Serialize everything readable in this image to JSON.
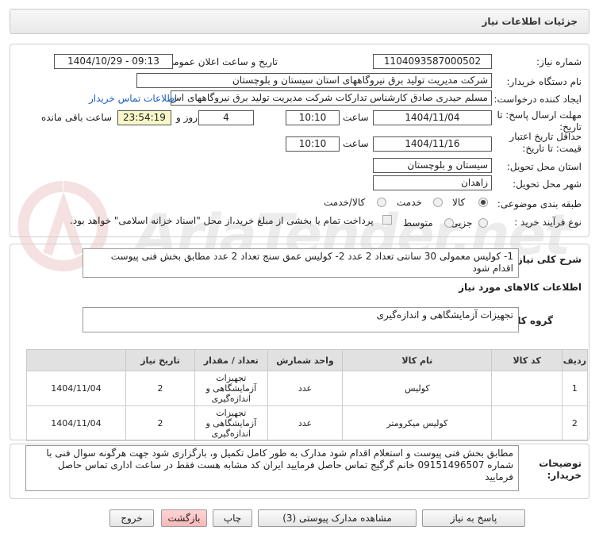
{
  "header": {
    "title": "جزئیات اطلاعات نیاز"
  },
  "watermark": {
    "text": "AriaTender.net"
  },
  "form": {
    "need_number": {
      "label": "شماره نیاز:",
      "value": "1104093587000502"
    },
    "announce": {
      "label": "تاریخ و ساعت اعلان عمومی:",
      "value": "1404/10/29 - 09:13"
    },
    "buyer": {
      "label": "نام دستگاه خریدار:",
      "value": "شرکت مدیریت تولید برق نیروگاههای استان سیستان و بلوچستان"
    },
    "creator": {
      "label": "ایجاد کننده درخواست:",
      "value": "مسلم حیدری صادق کارشناس تدارکات شرکت مدیریت تولید برق نیروگاههای اس",
      "contact_link": "اطلاعات تماس خریدار"
    },
    "deadline": {
      "label_line1": "مهلت ارسال پاسخ: تا",
      "label_line2": "تاریخ:",
      "date": "1404/11/04",
      "time_label": "ساعت",
      "time": "10:10",
      "days": "4",
      "days_label": "روز و",
      "remaining": "23:54:19",
      "remaining_label": "ساعت باقی مانده"
    },
    "validity": {
      "label_line1": "حداقل تاریخ اعتبار",
      "label_line2": "قیمت: تا تاریخ:",
      "date": "1404/11/16",
      "time_label": "ساعت",
      "time": "10:10"
    },
    "province": {
      "label": "استان محل تحویل:",
      "value": "سیستان و بلوچستان"
    },
    "city": {
      "label": "شهر محل تحویل:",
      "value": "زاهدان"
    },
    "category": {
      "label": "طبقه بندی موضوعی:",
      "options": [
        "کالا",
        "خدمت",
        "کالا/خدمت"
      ],
      "selected": "کالا"
    },
    "process": {
      "label": "نوع فرآیند خرید :",
      "options": [
        "جزیی",
        "متوسط"
      ],
      "payment_note": "پرداخت تمام یا بخشی از مبلغ خرید،از محل \"اسناد خزانه اسلامی\" خواهد بود."
    }
  },
  "summary": {
    "label": "شرح کلی نیاز:",
    "text": "1- کولیس معمولی  30 سانتی  تعداد  2 عدد    2- کولیس عمق سنج   تعداد  2 عدد      مطابق بخش فنی پیوست اقدام شود"
  },
  "goods_info": {
    "title": "اطلاعات کالاهای مورد نیاز",
    "group_label": "گروه کالا:",
    "group_value": "تجهیزات آزمایشگاهی و اندازه‌گیری",
    "table": {
      "headers": [
        "ردیف",
        "کد کالا",
        "نام کالا",
        "واحد شمارش",
        "تعداد / مقدار",
        "تاریخ نیاز"
      ],
      "rows": [
        {
          "row": "1",
          "code": "",
          "name": "کولیس",
          "unit": "عدد",
          "qty": "2",
          "date": "1404/11/04",
          "group": "تجهیزات آزمایشگاهی و اندازه‌گیری"
        },
        {
          "row": "2",
          "code": "",
          "name": "کولیس میکرومتر",
          "unit": "عدد",
          "qty": "2",
          "date": "1404/11/04",
          "group": "تجهیزات آزمایشگاهی و اندازه‌گیری"
        }
      ]
    }
  },
  "buyer_notes": {
    "label_line1": "توضیحات",
    "label_line2": "خریدار:",
    "text": "مطابق بخش فنی پیوست و استعلام اقدام شود  مدارک به طور کامل تکمیل و، بارگزاری شود  جهت هرگونه سوال فنی با شماره 09151496507 خانم گرگیج تماس حاصل فرمایید ایران کد مشابه هست  فقط در ساعت اداری تماس حاصل فرمایید"
  },
  "buttons": {
    "reply": "پاسخ به نیاز",
    "docs": "مشاهده مدارک پیوستی (3)",
    "print": "چاپ",
    "back": "بازگشت",
    "exit": "خروج"
  }
}
